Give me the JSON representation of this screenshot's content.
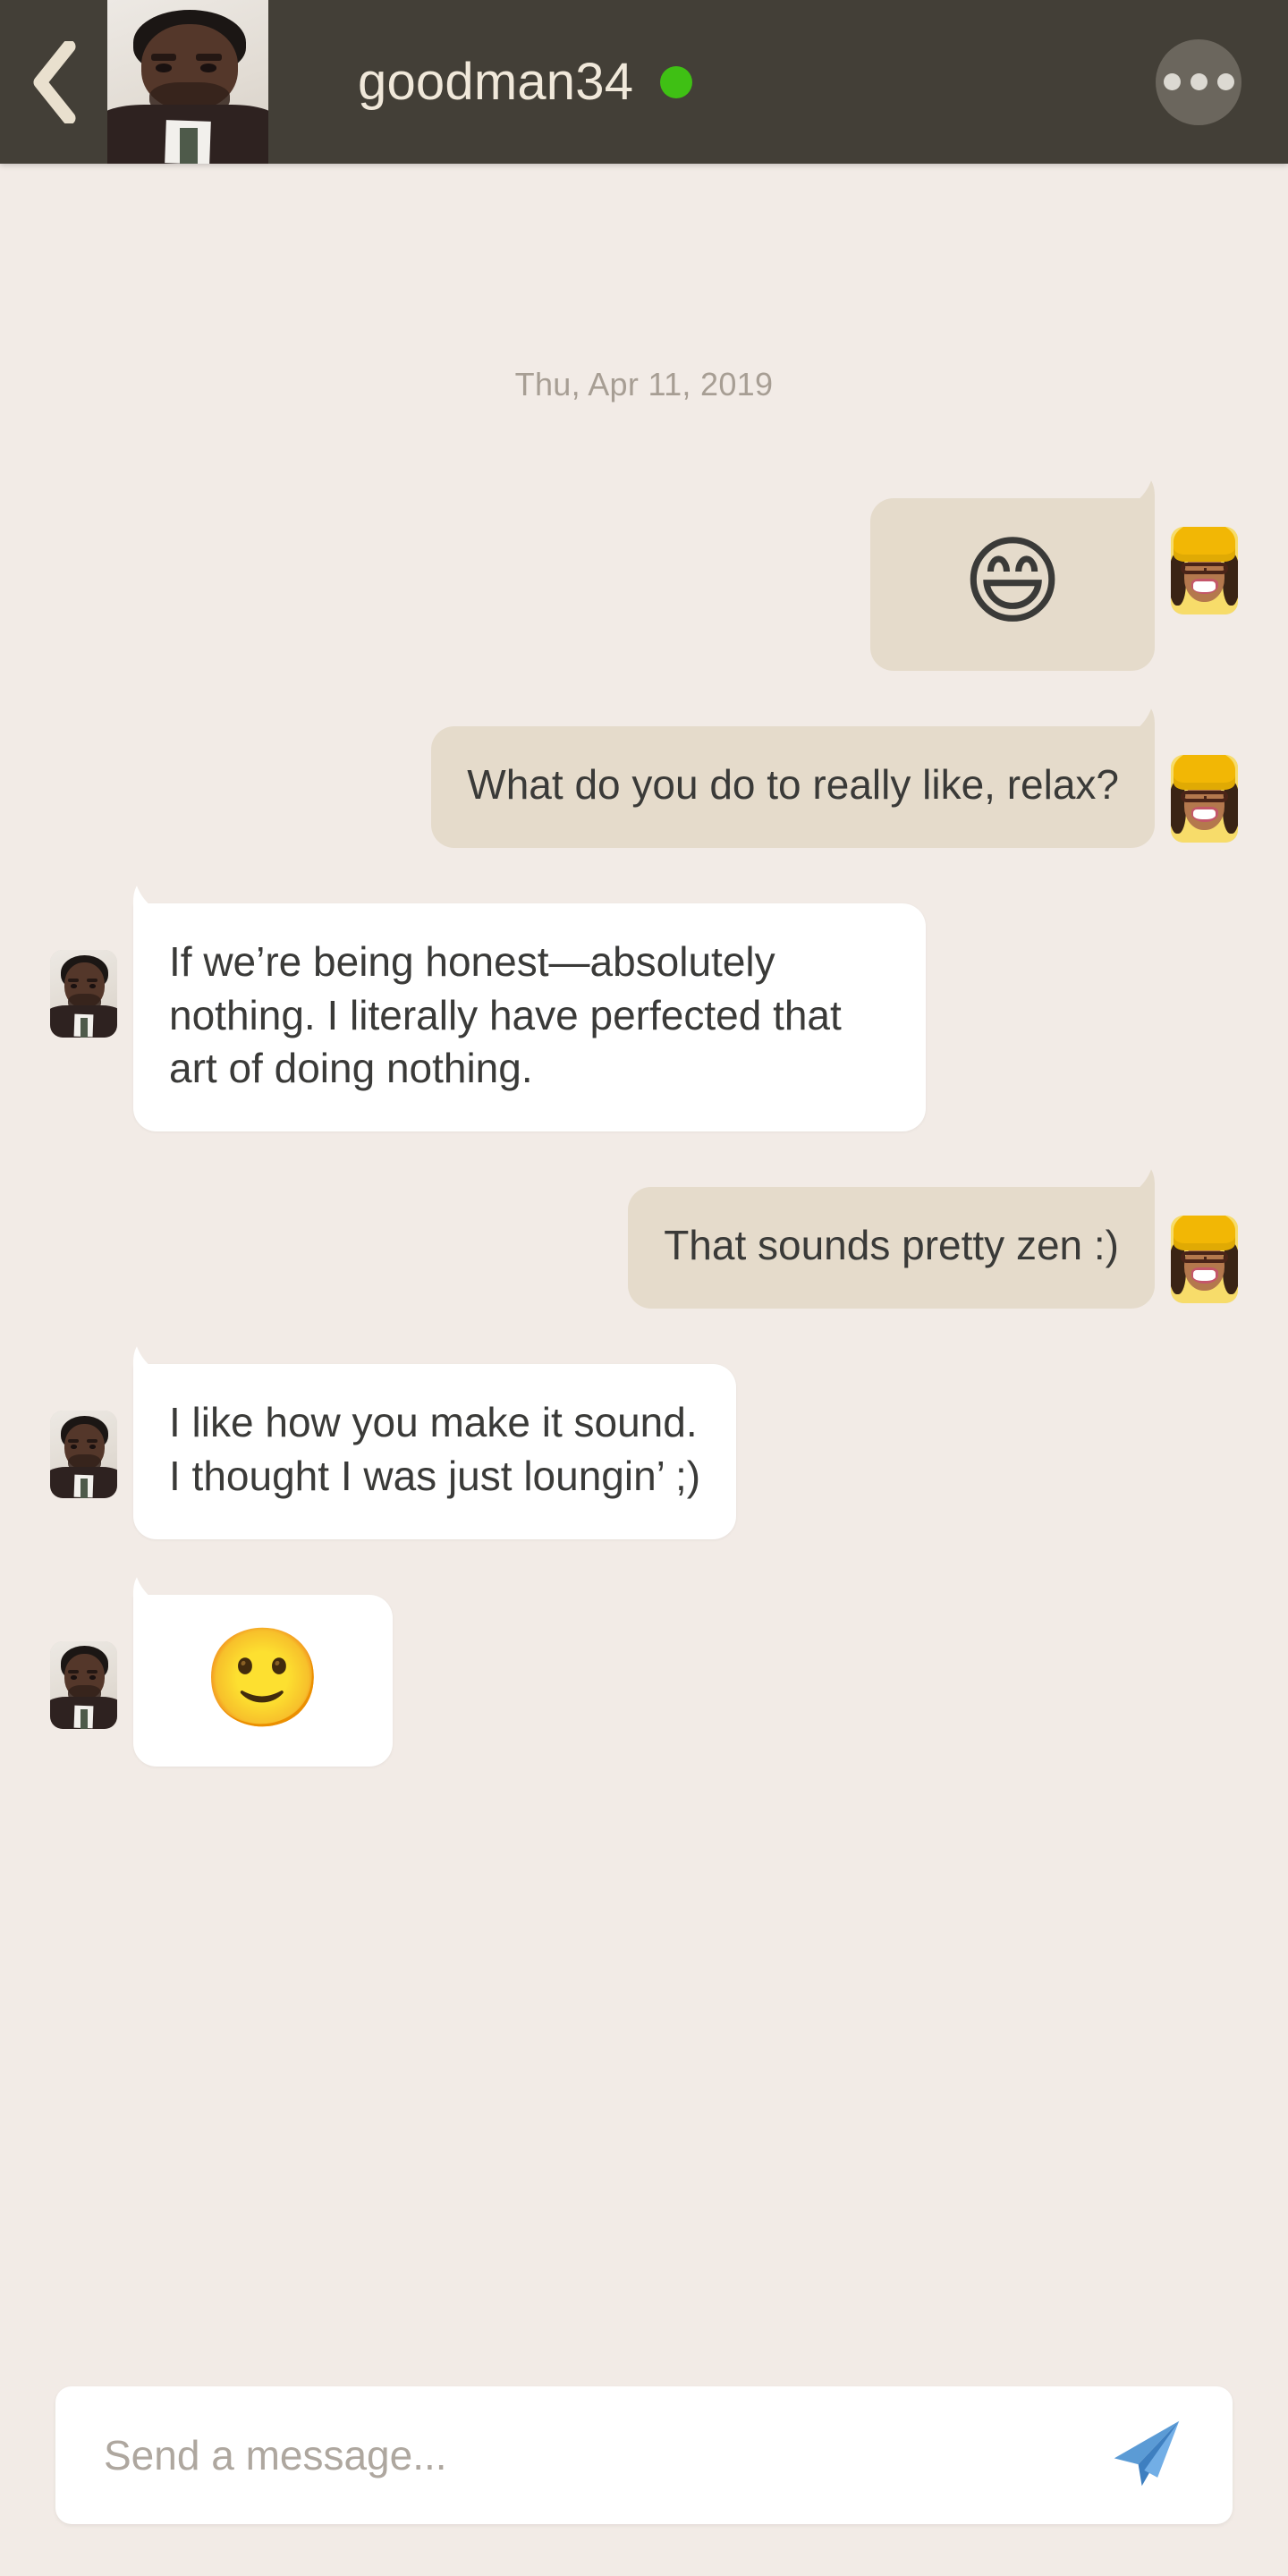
{
  "header": {
    "back_icon": "chevron-left-icon",
    "contact_avatar": "contact-photo-man",
    "title": "goodman34",
    "status": "online",
    "status_color": "#3FC014",
    "more_icon": "more-options-icon"
  },
  "conversation": {
    "date_separator": "Thu, Apr 11, 2019",
    "messages": [
      {
        "id": "m1",
        "direction": "outgoing",
        "type": "emoji",
        "text": "😄",
        "avatar": "user-photo-woman"
      },
      {
        "id": "m2",
        "direction": "outgoing",
        "type": "text",
        "text": "What do you do to really like, relax?",
        "avatar": "user-photo-woman"
      },
      {
        "id": "m3",
        "direction": "incoming",
        "type": "text",
        "text": "If we’re being honest—absolutely nothing.  I literally have perfected that art of doing nothing.",
        "avatar": "contact-photo-man"
      },
      {
        "id": "m4",
        "direction": "outgoing",
        "type": "text",
        "text": "That sounds pretty zen :)",
        "avatar": "user-photo-woman"
      },
      {
        "id": "m5",
        "direction": "incoming",
        "type": "text",
        "text": "I like how you make it sound.\nI thought I was just loungin’ ;)",
        "avatar": "contact-photo-man"
      },
      {
        "id": "m6",
        "direction": "incoming",
        "type": "emoji",
        "text": "🙂",
        "avatar": "contact-photo-man"
      }
    ]
  },
  "composer": {
    "placeholder": "Send a message...",
    "value": "",
    "send_icon": "send-paper-plane-icon",
    "send_icon_color": "#5B9BD5"
  },
  "theme": {
    "background": "#F2EBE6",
    "header_bg": "#433F37",
    "header_text": "#F0E8DA",
    "outgoing_bubble": "#E5DBCB",
    "incoming_bubble": "#FFFFFF",
    "message_text": "#3A3A38",
    "date_text": "#A79E94",
    "placeholder_text": "#AEA79F"
  }
}
